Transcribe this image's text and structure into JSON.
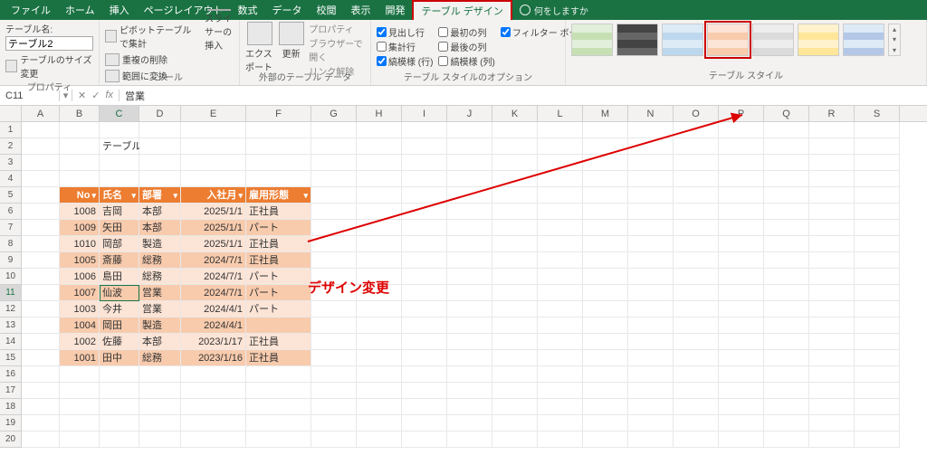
{
  "menu": {
    "items": [
      "ファイル",
      "ホーム",
      "挿入",
      "ページレイアウト",
      "数式",
      "データ",
      "校閲",
      "表示",
      "開発",
      "テーブル デザイン"
    ],
    "active": 9,
    "tell": "何をしますか"
  },
  "ribbon": {
    "prop": {
      "nameLabel": "テーブル名:",
      "nameValue": "テーブル2",
      "resize": "テーブルのサイズ変更",
      "group": "プロパティ"
    },
    "tool": {
      "pivot": "ピボットテーブルで集計",
      "dup": "重複の削除",
      "range": "範囲に変換",
      "slicer": "スライサーの挿入",
      "group": "ツール"
    },
    "ext": {
      "export": "エクスポート",
      "refresh": "更新",
      "p1": "プロパティ",
      "p2": "ブラウザーで開く",
      "p3": "リンク解除",
      "group": "外部のテーブル データ"
    },
    "opt": {
      "c1": "見出し行",
      "c2": "最初の列",
      "c3": "フィルター ボタン",
      "c4": "集計行",
      "c5": "最後の列",
      "c6": "縞模様 (行)",
      "c7": "縞模様 (列)",
      "group": "テーブル スタイルのオプション"
    },
    "style": {
      "group": "テーブル スタイル"
    }
  },
  "swatches": [
    [
      "#e2efda",
      "#c6e0b4",
      "#e2efda",
      "#c6e0b4"
    ],
    [
      "#444",
      "#666",
      "#444",
      "#666"
    ],
    [
      "#ddebf7",
      "#bdd7ee",
      "#ddebf7",
      "#bdd7ee"
    ],
    [
      "#fce4d6",
      "#f8cbad",
      "#fce4d6",
      "#f8cbad"
    ],
    [
      "#ededed",
      "#dbdbdb",
      "#ededed",
      "#dbdbdb"
    ],
    [
      "#fff2cc",
      "#ffe699",
      "#fff2cc",
      "#ffe699"
    ],
    [
      "#deebf7",
      "#b4c7e7",
      "#deebf7",
      "#b4c7e7"
    ]
  ],
  "swatchSel": 3,
  "fbar": {
    "ref": "C11",
    "val": "営業"
  },
  "cols": [
    "A",
    "B",
    "C",
    "D",
    "E",
    "F",
    "G",
    "H",
    "I",
    "J",
    "K",
    "L",
    "M",
    "N",
    "O",
    "P",
    "Q",
    "R",
    "S"
  ],
  "colW": [
    "wA",
    "wB",
    "wC",
    "wD",
    "wE",
    "wF",
    "",
    "",
    "",
    "",
    "",
    "",
    "",
    "",
    "",
    "",
    "",
    "",
    ""
  ],
  "title": "テーブルの基本設定",
  "annotation": "デザイン変更",
  "table": {
    "headers": [
      "No",
      "氏名",
      "部署",
      "入社月",
      "雇用形態"
    ],
    "rows": [
      [
        "1008",
        "吉岡",
        "本部",
        "2025/1/1",
        "正社員"
      ],
      [
        "1009",
        "矢田",
        "本部",
        "2025/1/1",
        "パート"
      ],
      [
        "1010",
        "岡部",
        "製造",
        "2025/1/1",
        "正社員"
      ],
      [
        "1005",
        "斎藤",
        "総務",
        "2024/7/1",
        "正社員"
      ],
      [
        "1006",
        "島田",
        "総務",
        "2024/7/1",
        "パート"
      ],
      [
        "1007",
        "仙波",
        "営業",
        "2024/7/1",
        "パート"
      ],
      [
        "1003",
        "今井",
        "営業",
        "2024/4/1",
        "パート"
      ],
      [
        "1004",
        "岡田",
        "製造",
        "2024/4/1",
        ""
      ],
      [
        "1002",
        "佐藤",
        "本部",
        "2023/1/17",
        "正社員"
      ],
      [
        "1001",
        "田中",
        "総務",
        "2023/1/16",
        "正社員"
      ]
    ]
  },
  "activeCell": {
    "row": 11,
    "col": 2
  }
}
